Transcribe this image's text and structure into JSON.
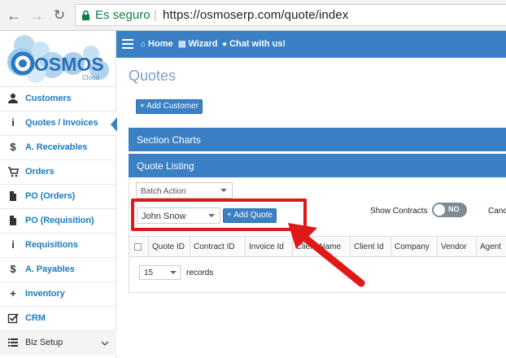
{
  "browser": {
    "secure_label": "Es seguro",
    "url": "https://osmoserp.com/quote/index"
  },
  "logo": {
    "text": "OSMOS",
    "sub": "Cloud"
  },
  "sidebar": {
    "items": [
      {
        "label": "Customers",
        "icon": "user-icon"
      },
      {
        "label": "Quotes / Invoices",
        "icon": "info-icon",
        "active": true
      },
      {
        "label": "A. Receivables",
        "icon": "dollar-icon"
      },
      {
        "label": "Orders",
        "icon": "cart-icon"
      },
      {
        "label": "PO (Orders)",
        "icon": "file-icon"
      },
      {
        "label": "PO (Requisition)",
        "icon": "file-icon"
      },
      {
        "label": "Requisitions",
        "icon": "info-icon"
      },
      {
        "label": "A. Payables",
        "icon": "dollar-icon"
      },
      {
        "label": "Inventory",
        "icon": "plus-icon"
      },
      {
        "label": "CRM",
        "icon": "checkbox-icon"
      },
      {
        "label": "Biz Setup",
        "icon": "list-icon"
      }
    ]
  },
  "topbar": {
    "home": "Home",
    "wizard": "Wizard",
    "chat": "Chat with us!"
  },
  "main": {
    "title": "Quotes",
    "add_customer": "Add Customer",
    "section_charts": "Section Charts",
    "quote_listing": "Quote Listing",
    "batch_action": "Batch Action",
    "user_select": "John Snow",
    "add_quote": "Add Quote",
    "show_contracts": "Show Contracts",
    "toggle": "NO",
    "cancel_partial": "Canc",
    "columns": [
      "Quote ID",
      "Contract ID",
      "Invoice Id",
      "Client Name",
      "Client Id",
      "Company",
      "Vendor",
      "Agent"
    ],
    "records_value": "15",
    "records_label": "records"
  },
  "colors": {
    "accent": "#3a80c4",
    "highlight": "#e01818",
    "link": "#1c7cc0"
  }
}
